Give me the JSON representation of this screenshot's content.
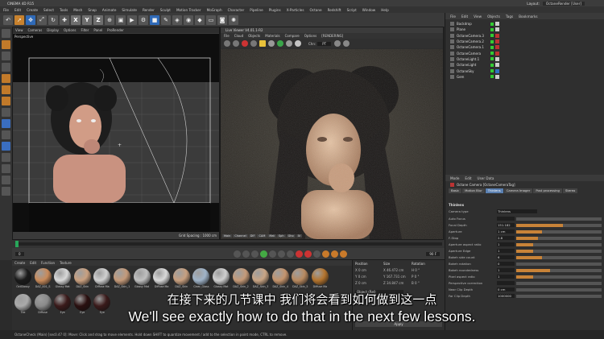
{
  "window": {
    "title": "CINEMA 4D R15",
    "layout_label": "Layout:",
    "layout_value": "OctaneRender [User]"
  },
  "menubar": [
    "File",
    "Edit",
    "Create",
    "Select",
    "Tools",
    "Mesh",
    "Snap",
    "Animate",
    "Simulate",
    "Render",
    "Sculpt",
    "Motion Tracker",
    "MoGraph",
    "Character",
    "Pipeline",
    "Plugins",
    "X-Particles",
    "Octane",
    "Redshift",
    "Script",
    "Window",
    "Help"
  ],
  "toolbar": {
    "axis_keys": [
      "X",
      "Y",
      "Z"
    ]
  },
  "viewport": {
    "menu": [
      "View",
      "Cameras",
      "Display",
      "Options",
      "Filter",
      "Panel",
      "ProRender"
    ],
    "label": "Perspective",
    "grid_spacing": "Grid Spacing : 1000 cm"
  },
  "live_viewer": {
    "title": "Live Viewer V4.01.1-R2",
    "menu": [
      "File",
      "Cloud",
      "Objects",
      "Materials",
      "Compare",
      "Options",
      "[RENDERING]"
    ],
    "channel_label": "Chn:",
    "channel_value": "PT",
    "tabs": [
      "Main",
      "Channel",
      "DIF",
      "CAM",
      "Mat",
      "Sph",
      "Gho",
      "IV"
    ]
  },
  "objects": {
    "menu": [
      "File",
      "Edit",
      "View",
      "Objects",
      "Tags",
      "Bookmarks"
    ],
    "items": [
      {
        "name": "Backdrop",
        "tag": "w"
      },
      {
        "name": "Plane",
        "tag": "w"
      },
      {
        "name": "OctaneCamera.3",
        "tag": "r"
      },
      {
        "name": "OctaneCamera.2",
        "tag": "r"
      },
      {
        "name": "OctaneCamera.1",
        "tag": "r"
      },
      {
        "name": "OctaneCamera",
        "tag": "r"
      },
      {
        "name": "OctaneLight.1",
        "tag": "w"
      },
      {
        "name": "OctaneLight",
        "tag": "w"
      },
      {
        "name": "OctaneSky",
        "tag": "bl"
      },
      {
        "name": "Gem",
        "tag": "w"
      }
    ]
  },
  "attributes": {
    "menu": [
      "Mode",
      "Edit",
      "User Data"
    ],
    "title": "Octane Camera [OctaneCameraTag]",
    "tabs": [
      "Basic",
      "Motion Blur",
      "Thinlens",
      "Camera Imager",
      "Post processing",
      "Stereo"
    ],
    "active_tab": "Thinlens",
    "section": "Thinlens",
    "camera_type_label": "Camera type",
    "camera_type_value": "Thinlens",
    "rows": [
      {
        "label": "Auto Focus",
        "value": "",
        "fill": 0
      },
      {
        "label": "Focal Depth",
        "value": "151.182",
        "fill": 0.55
      },
      {
        "label": "Aperture",
        "value": "1 cm",
        "fill": 0.3
      },
      {
        "label": "F-Stop",
        "value": "2.8",
        "fill": 0.25
      },
      {
        "label": "Aperture aspect ratio",
        "value": "1",
        "fill": 0.2
      },
      {
        "label": "Aperture Edge",
        "value": "1",
        "fill": 0.2
      },
      {
        "label": "Bokeh side count",
        "value": "6",
        "fill": 0.3
      },
      {
        "label": "Bokeh rotation",
        "value": "0",
        "fill": 0
      },
      {
        "label": "Bokeh roundedness",
        "value": "1",
        "fill": 0.4
      },
      {
        "label": "Pixel aspect ratio",
        "value": "1",
        "fill": 0.2
      },
      {
        "label": "Perspective correction",
        "value": "",
        "fill": 0
      },
      {
        "label": "Near Clip Depth",
        "value": "0 cm",
        "fill": 0
      },
      {
        "label": "Far Clip Depth",
        "value": "1000000",
        "fill": 0
      }
    ]
  },
  "timeline": {
    "frame_start": "0",
    "frame_end": "90 F"
  },
  "materials": {
    "menu": [
      "Create",
      "Edit",
      "Function",
      "Texture"
    ],
    "row1": [
      {
        "label": "OctGlossy",
        "color": "#1a1a1a"
      },
      {
        "label": "DAZ_001_S",
        "color": "#c98b5b"
      },
      {
        "label": "Glossy Mat",
        "color": "#d8d8d8"
      },
      {
        "label": "DAZ_Skin",
        "color": "#c9a080"
      },
      {
        "label": "Diffuse Ma",
        "color": "#d0d0d0"
      },
      {
        "label": "DAZ_Skin_1",
        "color": "#c49a7a"
      },
      {
        "label": "Glossy Mat",
        "color": "#bfbfbf"
      },
      {
        "label": "Diffuse Ma",
        "color": "#d9d9d9"
      },
      {
        "label": "DAZ_Skin",
        "color": "#c79f7f"
      },
      {
        "label": "Clear_Glass",
        "color": "#9fb3c8"
      },
      {
        "label": "Glossy Mat",
        "color": "#cfcfcf"
      },
      {
        "label": "DAZ_Skin_2",
        "color": "#c59a78"
      },
      {
        "label": "DAZ_Skin_3",
        "color": "#c9a585"
      },
      {
        "label": "DAZ_Skin_4",
        "color": "#c4946d"
      },
      {
        "label": "DAZ_Skin_5",
        "color": "#b98a60"
      },
      {
        "label": "Diffuse Ma",
        "color": "#b3742e"
      }
    ],
    "row2": [
      {
        "label": "Tile",
        "color": "#aaaaaa"
      },
      {
        "label": "Diffuse",
        "color": "#8a8a8a"
      },
      {
        "label": "Eye",
        "color": "#3a1a1a"
      },
      {
        "label": "Eye",
        "color": "#2a1010"
      },
      {
        "label": "Eye",
        "color": "#3a1a1a"
      }
    ]
  },
  "coordinates": {
    "headers": [
      "Position",
      "Size",
      "Rotation"
    ],
    "rows": [
      [
        "X  0 cm",
        "X  46.472 cm",
        "H  0 °"
      ],
      [
        "Y  0 cm",
        "Y  167.731 cm",
        "P  0 °"
      ],
      [
        "Z  0 cm",
        "Z  34.847 cm",
        "B  0 °"
      ]
    ],
    "mode": "Object (Rel)",
    "apply": "Apply"
  },
  "subtitles": {
    "chinese": "在接下来的几节课中 我们将会看到如何做到这一点",
    "english": "We'll see exactly how to do that in the next few lessons."
  },
  "status": "OctaneCheck (Main) [sec0.47 0]: Move: Click and drag to move elements. Hold down SHIFT to quantize movement / add to the selection in point mode, CTRL to remove."
}
